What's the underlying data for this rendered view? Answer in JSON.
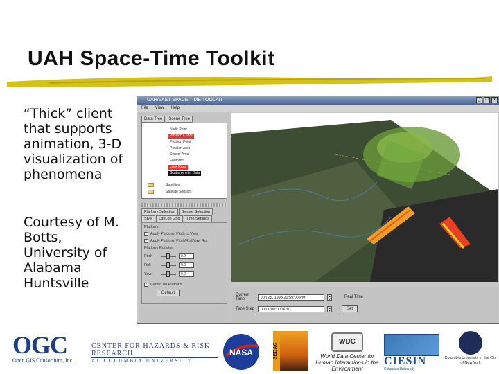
{
  "slide": {
    "title": "UAH Space-Time Toolkit",
    "bullets": [
      "“Thick” client that supports animation, 3-D visualization of phenomena",
      "Courtesy of M. Botts, University of Alabama Huntsville"
    ]
  },
  "window": {
    "title": "UAH/VAST SPACE TIME TOOLKIT",
    "controls": [
      "_",
      "□",
      "x"
    ],
    "menu": [
      "File",
      "View",
      "Help"
    ],
    "top_tabs": [
      "Data Tree",
      "Scene Tree"
    ],
    "tree_items": [
      {
        "label": "Nadir Point",
        "style": "plain"
      },
      {
        "label": "Position Curve",
        "style": "red"
      },
      {
        "label": "Position Point",
        "style": "plain"
      },
      {
        "label": "Position Area",
        "style": "plain"
      },
      {
        "label": "Sensor Area",
        "style": "plain"
      },
      {
        "label": "Footprint",
        "style": "plain"
      },
      {
        "label": "Look Rays",
        "style": "red"
      },
      {
        "label": "Scatterometer Data",
        "style": "black"
      }
    ],
    "tree_folders": [
      "Satellites",
      "Satellite Sensors"
    ],
    "lower_tabs_row1": [
      "Platform Selection",
      "Sensor Selection"
    ],
    "lower_tabs_row2": [
      "Style",
      "Lat/Lon Grid",
      "Time Settings"
    ],
    "panel": {
      "section_label": "Platform",
      "checkbox1": "Apply Platform Pitch to View",
      "checkbox2": "Apply Platform Pitch/Roll/Yaw Rot",
      "rotation_label": "Platform Rotation",
      "sliders": [
        {
          "label": "Pitch",
          "value": "0.0"
        },
        {
          "label": "Roll",
          "value": "0.0"
        },
        {
          "label": "Yaw",
          "value": "0.0"
        }
      ],
      "checkbox3": "Center on Platform",
      "default_button": "Default"
    },
    "time": {
      "current_label": "Current Time",
      "current_value": "Jun 25, 1998 21:59:00 PM",
      "stop_label": "Time Step",
      "stop_value": "00:00:00:00:00:01",
      "real_time_label": "Real Time",
      "set_button": "Set"
    }
  },
  "logos": {
    "ogc": "OGC",
    "ogc_sub": "Open GIS Consortium, Inc.",
    "chrr": "CENTER FOR HAZARDS & RISK RESEARCH",
    "chrr_sub": "AT COLUMBIA UNIVERSITY",
    "nasa": "NASA",
    "sedac": "SEDAC",
    "wdc": "WDC",
    "wdc_text": "World Data Center for Human Interactions in the Environment",
    "ciesin": "CIESIN",
    "ciesin_sub": "Columbia University",
    "columbia": "Columbia University in the City of New York"
  }
}
